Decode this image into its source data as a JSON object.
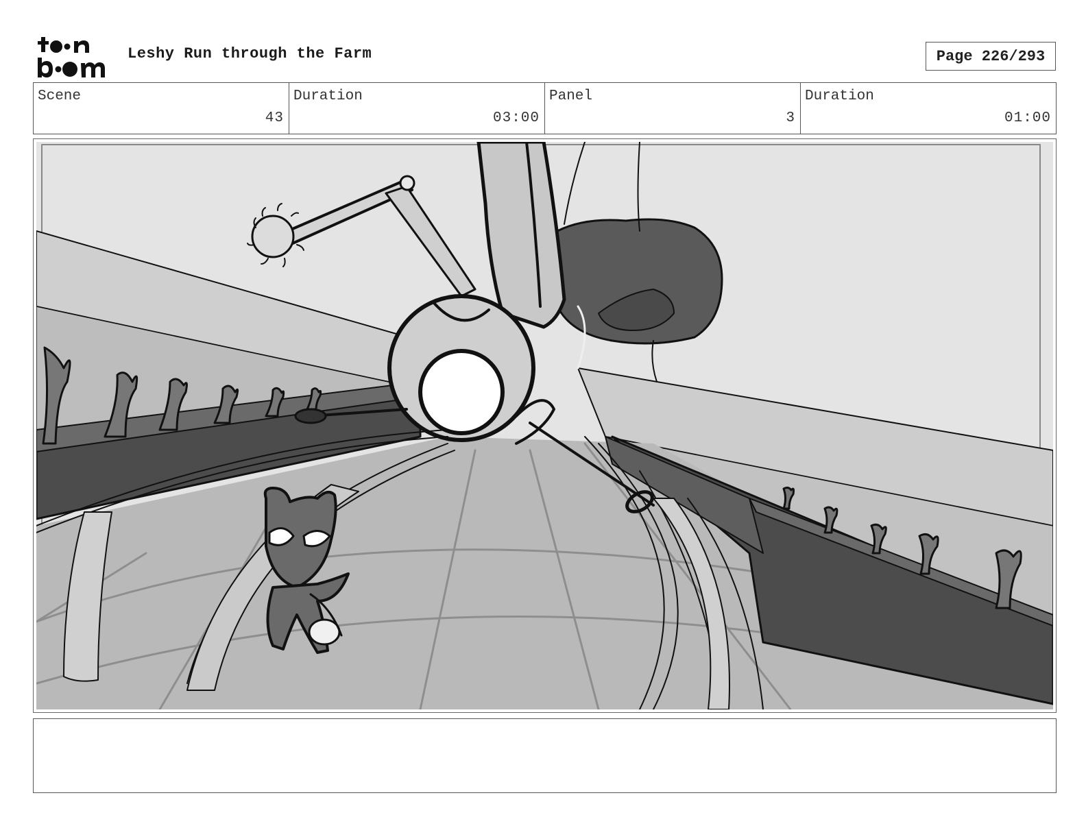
{
  "header": {
    "title": "Leshy Run through the Farm",
    "page_label": "Page 226/293"
  },
  "info": {
    "scene_label": "Scene",
    "scene_value": "43",
    "scene_duration_label": "Duration",
    "scene_duration_value": "03:00",
    "panel_label": "Panel",
    "panel_value": "3",
    "panel_duration_label": "Duration",
    "panel_duration_value": "01:00"
  },
  "notes": {
    "text": ""
  },
  "colors": {
    "sky": "#e4e4e4",
    "ground": "#b9b9b9",
    "dark_bed": "#4c4c4c",
    "tree": "#5a5a5a",
    "line": "#111111"
  }
}
